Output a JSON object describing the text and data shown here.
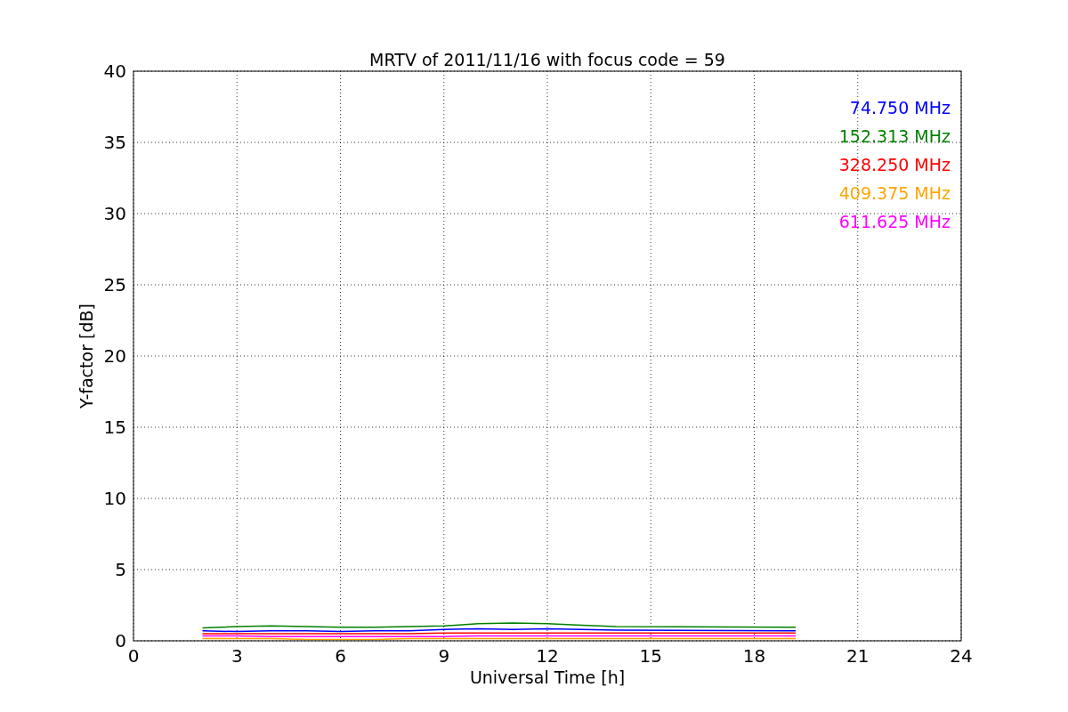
{
  "chart_data": {
    "type": "line",
    "title": "MRTV of 2011/11/16 with focus code = 59",
    "xlabel": "Universal Time [h]",
    "ylabel": "Y-factor [dB]",
    "x": [
      2,
      3,
      4,
      5,
      6,
      7,
      8,
      9,
      10,
      11,
      12,
      13,
      14,
      19,
      19.2
    ],
    "series": [
      {
        "name": "74.750 MHz",
        "color": "#0000ff",
        "values": [
          0.7,
          0.65,
          0.7,
          0.7,
          0.65,
          0.7,
          0.7,
          0.8,
          0.85,
          0.8,
          0.85,
          0.8,
          0.75,
          0.7,
          0.7
        ]
      },
      {
        "name": "152.313 MHz",
        "color": "#008000",
        "values": [
          0.9,
          1.0,
          1.05,
          1.0,
          0.95,
          0.95,
          1.0,
          1.05,
          1.2,
          1.25,
          1.2,
          1.1,
          1.0,
          0.95,
          0.95
        ]
      },
      {
        "name": "328.250 MHz",
        "color": "#ff0000",
        "values": [
          0.5,
          0.5,
          0.5,
          0.5,
          0.5,
          0.5,
          0.5,
          0.55,
          0.55,
          0.55,
          0.55,
          0.55,
          0.55,
          0.55,
          0.55
        ]
      },
      {
        "name": "409.375 MHz",
        "color": "#ffa500",
        "values": [
          0.15,
          0.15,
          0.15,
          0.1,
          0.1,
          0.1,
          0.15,
          0.15,
          0.15,
          0.15,
          0.15,
          0.15,
          0.15,
          0.15,
          0.15
        ]
      },
      {
        "name": "611.625 MHz",
        "color": "#ff00ff",
        "values": [
          0.35,
          0.35,
          0.3,
          0.3,
          0.3,
          0.3,
          0.3,
          0.3,
          0.35,
          0.35,
          0.35,
          0.35,
          0.35,
          0.35,
          0.35
        ]
      }
    ],
    "xlim": [
      0,
      24
    ],
    "ylim": [
      0,
      40
    ],
    "xticks": [
      0,
      3,
      6,
      9,
      12,
      15,
      18,
      21,
      24
    ],
    "yticks": [
      0,
      5,
      10,
      15,
      20,
      25,
      30,
      35,
      40
    ],
    "grid": true
  }
}
